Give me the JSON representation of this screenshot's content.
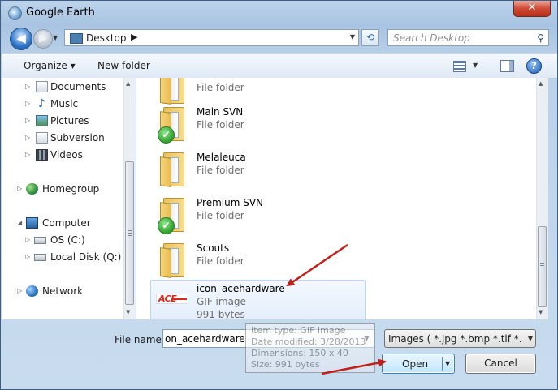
{
  "window": {
    "title": "Google Earth",
    "close_glyph": "✕"
  },
  "navigation": {
    "back_glyph": "◀",
    "forward_glyph": "▶",
    "dropdown_glyph": "▼"
  },
  "address": {
    "location": "Desktop",
    "chevron": "▶",
    "dropdown_glyph": "▼"
  },
  "refresh": {
    "glyph": "⟲"
  },
  "search": {
    "placeholder": "Search Desktop",
    "icon_glyph": "⚲"
  },
  "toolbar": {
    "organize_label": "Organize ▾",
    "new_folder_label": "New folder",
    "help_glyph": "?",
    "view_dropdown_glyph": "▼"
  },
  "nav_pane": {
    "items": [
      {
        "label": "Documents",
        "icon": "documents-icon",
        "expander": "▷"
      },
      {
        "label": "Music",
        "icon": "music-icon",
        "expander": "▷"
      },
      {
        "label": "Pictures",
        "icon": "pictures-icon",
        "expander": "▷"
      },
      {
        "label": "Subversion",
        "icon": "subversion-icon",
        "expander": "▷"
      },
      {
        "label": "Videos",
        "icon": "videos-icon",
        "expander": "▷"
      },
      {
        "label": "Homegroup",
        "icon": "homegroup-icon",
        "expander": "▷"
      },
      {
        "label": "Computer",
        "icon": "computer-icon",
        "expander": "◢"
      },
      {
        "label": "OS (C:)",
        "icon": "drive-icon",
        "expander": "▷"
      },
      {
        "label": "Local Disk (Q:)",
        "icon": "drive-icon",
        "expander": "▷"
      },
      {
        "label": "Network",
        "icon": "network-icon",
        "expander": "▷"
      }
    ]
  },
  "files": [
    {
      "name": "",
      "type": "File folder",
      "size": "",
      "icon": "folder-icon",
      "svn": false
    },
    {
      "name": "Main SVN",
      "type": "File folder",
      "size": "",
      "icon": "folder-icon",
      "svn": true
    },
    {
      "name": "Melaleuca",
      "type": "File folder",
      "size": "",
      "icon": "folder-icon",
      "svn": false
    },
    {
      "name": "Premium SVN",
      "type": "File folder",
      "size": "",
      "icon": "folder-icon",
      "svn": true
    },
    {
      "name": "Scouts",
      "type": "File folder",
      "size": "",
      "icon": "folder-icon",
      "svn": false
    },
    {
      "name": "icon_acehardware",
      "type": "GIF image",
      "size": "991 bytes",
      "icon": "ace-hardware-thumbnail-icon",
      "thumb_text": "ACE",
      "selected": true
    }
  ],
  "footer": {
    "filename_label": "File name:",
    "filename_value": "on_acehardware",
    "filetype_value": "Images ( *.jpg *.bmp *.tif *.tga *",
    "open_label": "Open",
    "cancel_label": "Cancel",
    "dropdown_glyph": "▼"
  },
  "tooltip": {
    "lines": [
      "Item type: GIF Image",
      "Date modified: 3/28/2013",
      "Dimensions: 150 x 40",
      "Size: 991 bytes"
    ]
  },
  "colors": {
    "annotation_arrow": "#c0201b",
    "selection_border": "#b8d6fb",
    "window_frame": "#a8c4e2"
  }
}
